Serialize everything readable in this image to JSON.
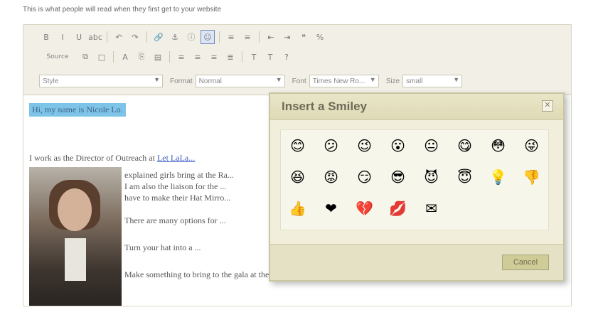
{
  "intro": "This is what people will read when they first get to your website",
  "toolbar": {
    "row1": [
      "B",
      "I",
      "U",
      "abc",
      "↶",
      "↷",
      "🔗",
      "⚓",
      "ⓘ",
      "☺",
      "≡",
      "≡",
      "⇤",
      "⇥",
      "❝",
      "%"
    ],
    "row2": [
      "Source",
      "⧉",
      "□",
      "A",
      "⎘",
      "▤",
      "≡",
      "≡",
      "≡",
      "≣",
      "T",
      "T",
      "?"
    ],
    "style_label": "Style",
    "format_label": "Format",
    "format_value": "Normal",
    "font_label": "Font",
    "font_value": "Times New Ro...",
    "size_label": "Size",
    "size_value": "small"
  },
  "content": {
    "highlight": "Hi, my name is Nicole Lo.",
    "para_text": "I work as the Director of Outreach at ",
    "para_link": "Let LaLa...",
    "lines": [
      "explained girls bring at the Ra...",
      "I am also the liaison for the ...",
      "have to make their Hat Mirro...",
      "There are many options for ...",
      "Turn your hat into a ...",
      "Make something to bring to the gala at the Dome"
    ]
  },
  "dialog": {
    "title": "Insert a Smiley",
    "close": "✕",
    "cancel": "Cancel",
    "smileys": [
      "😊",
      "😕",
      "😉",
      "😮",
      "😐",
      "😋",
      "😳",
      "😜",
      "😆",
      "😡",
      "😏",
      "😎",
      "😈",
      "😇",
      "💡",
      "👎",
      "👍",
      "❤",
      "💔",
      "💋",
      "✉"
    ]
  },
  "colors": {
    "highlight": "#7ec4e8",
    "dialog_bg": "#f1efdc",
    "link": "#3a5bc7"
  }
}
